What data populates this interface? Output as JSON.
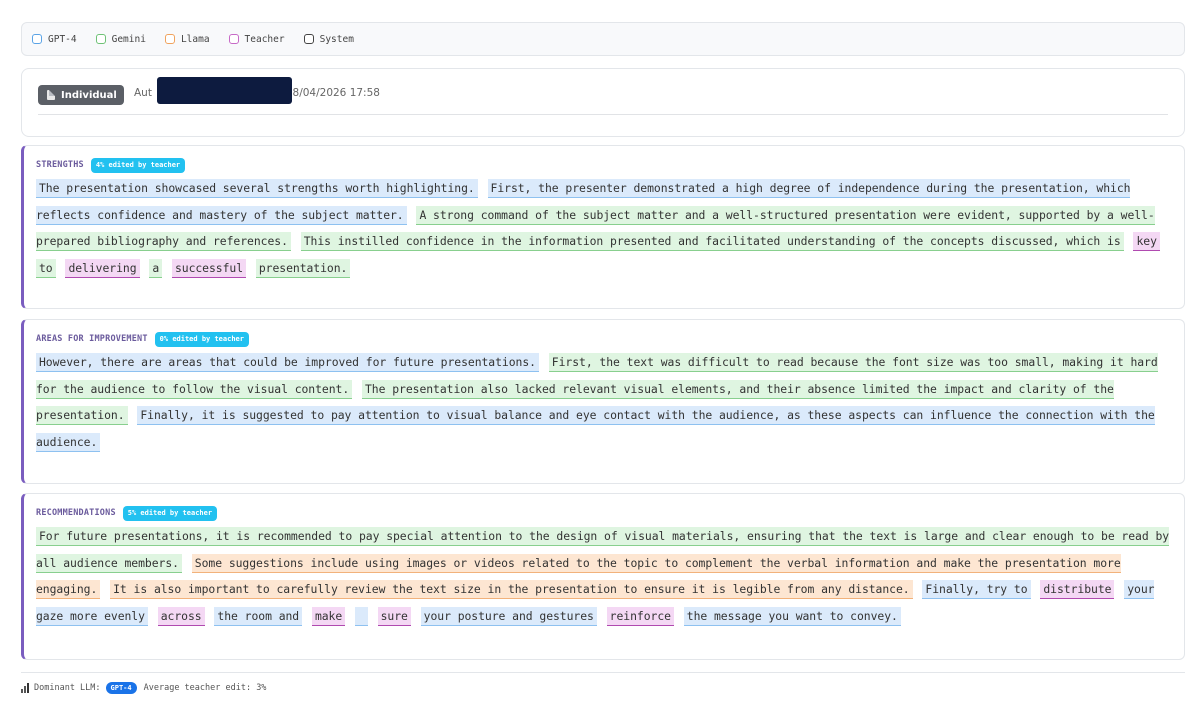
{
  "legend": [
    {
      "label": "GPT-4",
      "color": "#5aa3e6"
    },
    {
      "label": "Gemini",
      "color": "#6ec276"
    },
    {
      "label": "Llama",
      "color": "#f0a35e"
    },
    {
      "label": "Teacher",
      "color": "#c76ac7"
    },
    {
      "label": "System",
      "color": "#444444"
    }
  ],
  "header": {
    "badge": "Individual",
    "meta_prefix": "Aut",
    "meta_suffix": ": 28/04/2026 17:58"
  },
  "sections": [
    {
      "title": "STRENGTHS",
      "badge": "4% edited by teacher",
      "segments": [
        {
          "src": "gpt4",
          "text": "The presentation showcased several strengths worth highlighting."
        },
        {
          "src": "gpt4",
          "text": "First, the presenter demonstrated a high degree of independence during the presentation, which reflects confidence and mastery of the subject matter."
        },
        {
          "src": "gemini",
          "text": "A strong command of the subject matter and a well-structured presentation were evident, supported by a well-prepared bibliography and references."
        },
        {
          "src": "gemini",
          "text": "This instilled confidence in the information presented and facilitated understanding of the concepts discussed, which is"
        },
        {
          "src": "teacher",
          "text": "key"
        },
        {
          "src": "gemini",
          "text": "to"
        },
        {
          "src": "teacher",
          "text": "delivering"
        },
        {
          "src": "gemini",
          "text": "a"
        },
        {
          "src": "teacher",
          "text": "successful"
        },
        {
          "src": "gemini",
          "text": "presentation."
        }
      ]
    },
    {
      "title": "AREAS FOR IMPROVEMENT",
      "badge": "0% edited by teacher",
      "segments": [
        {
          "src": "gpt4",
          "text": "However, there are areas that could be improved for future presentations."
        },
        {
          "src": "gemini",
          "text": "First, the text was difficult to read because the font size was too small, making it hard for the audience to follow the visual content."
        },
        {
          "src": "gemini",
          "text": "The presentation also lacked relevant visual elements, and their absence limited the impact and clarity of the presentation."
        },
        {
          "src": "gpt4",
          "text": "Finally, it is suggested to pay attention to visual balance and eye contact with the audience, as these aspects can influence the connection with the audience."
        }
      ]
    },
    {
      "title": "RECOMMENDATIONS",
      "badge": "5% edited by teacher",
      "segments": [
        {
          "src": "gemini",
          "text": "For future presentations, it is recommended to pay special attention to the design of visual materials, ensuring that the text is large and clear enough to be read by all audience members."
        },
        {
          "src": "llama",
          "text": "Some suggestions include using images or videos related to the topic to complement the verbal information and make the presentation more engaging."
        },
        {
          "src": "llama",
          "text": "It is also important to carefully review the text size in the presentation to ensure it is legible from any distance."
        },
        {
          "src": "gpt4",
          "text": "Finally, try to"
        },
        {
          "src": "teacher",
          "text": "distribute"
        },
        {
          "src": "gpt4",
          "text": "your gaze more evenly"
        },
        {
          "src": "teacher",
          "text": "across"
        },
        {
          "src": "gpt4",
          "text": "the room and"
        },
        {
          "src": "teacher",
          "text": "make"
        },
        {
          "src": "gpt4",
          "text": ""
        },
        {
          "src": "teacher",
          "text": "sure"
        },
        {
          "src": "gpt4",
          "text": "your posture and gestures"
        },
        {
          "src": "teacher",
          "text": "reinforce"
        },
        {
          "src": "gpt4",
          "text": "the message you want to convey."
        }
      ]
    }
  ],
  "footer": {
    "dominant_label": "Dominant LLM:",
    "dominant_value": "GPT-4",
    "avg_label": "Average teacher edit: 3%"
  }
}
